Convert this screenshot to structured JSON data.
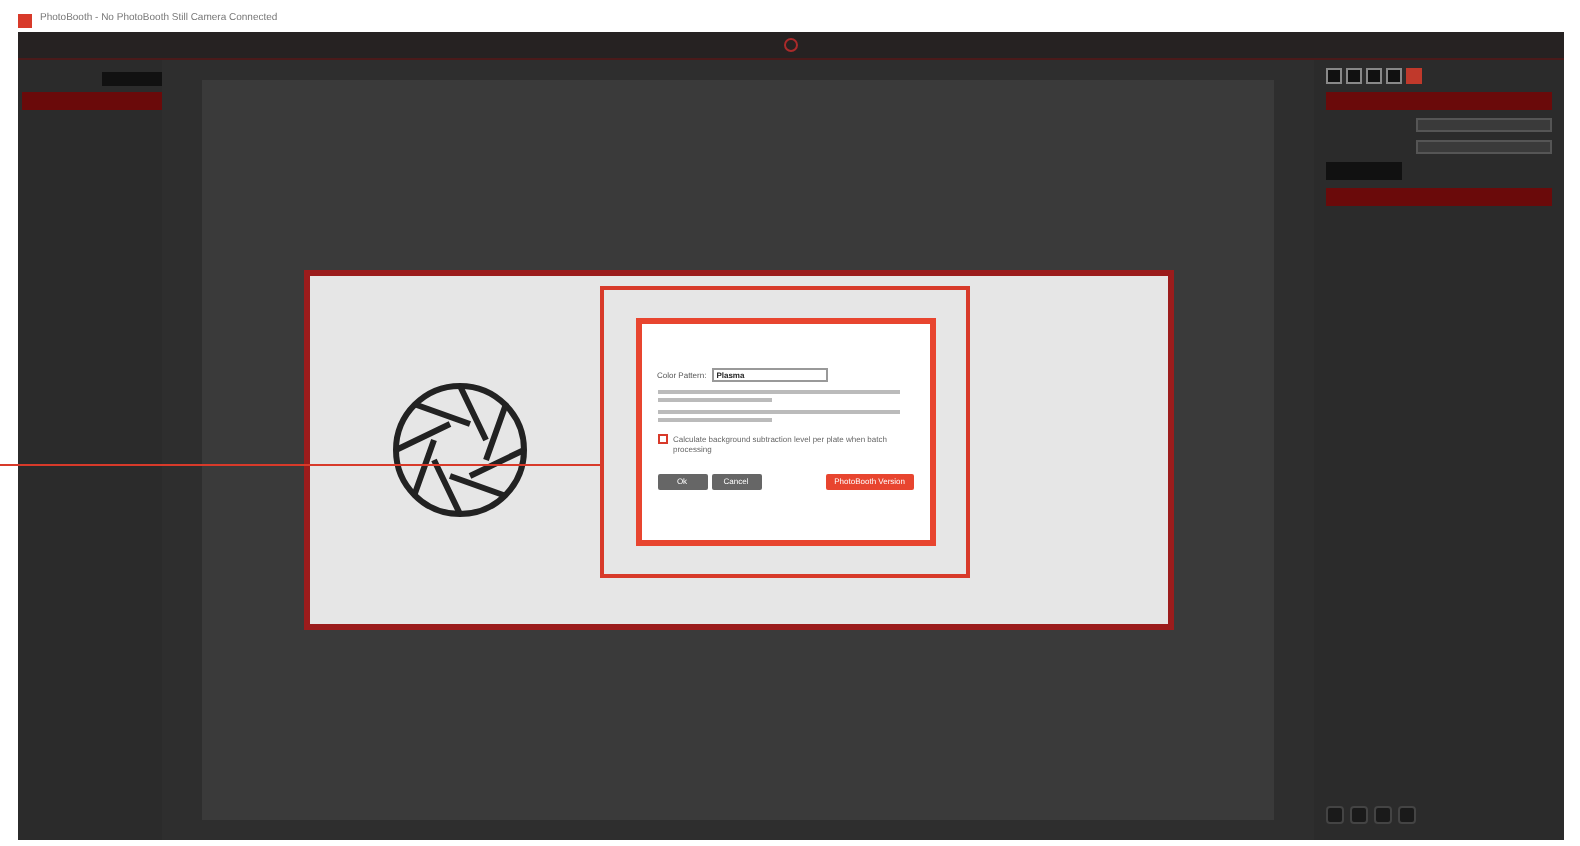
{
  "window": {
    "title": "PhotoBooth - No PhotoBooth Still Camera Connected"
  },
  "dialog": {
    "color_pattern_label": "Color Pattern:",
    "color_pattern_value": "Plasma",
    "checkbox": {
      "label": "Calculate background subtraction level per plate when batch processing",
      "checked": false
    },
    "buttons": [
      {
        "label": "Ok",
        "kind": "plain"
      },
      {
        "label": "Cancel",
        "kind": "plain"
      },
      {
        "label": "PhotoBooth Version",
        "kind": "accent"
      }
    ]
  }
}
